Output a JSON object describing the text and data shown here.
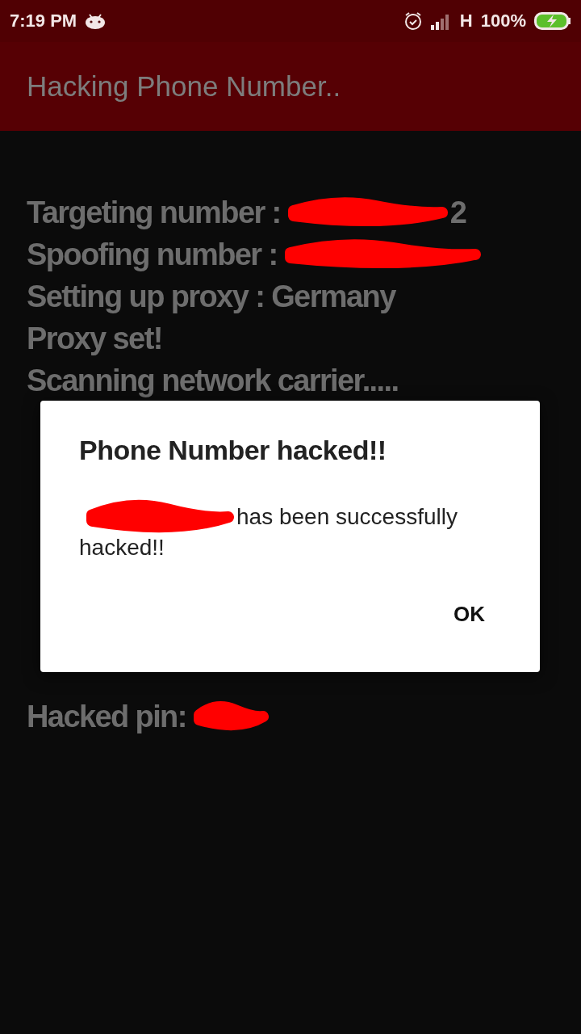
{
  "status_bar": {
    "time": "7:19 PM",
    "network": "H",
    "battery": "100%"
  },
  "app_bar": {
    "title": "Hacking Phone Number.."
  },
  "log": [
    {
      "kind": "text",
      "text": "Targeting number :",
      "redacted": true,
      "suffix": "2"
    },
    {
      "kind": "text",
      "text": "Spoofing number :",
      "redacted": true
    },
    {
      "kind": "text",
      "text": "Setting up proxy : Germany",
      "redacted": false
    },
    {
      "kind": "text",
      "text": "Proxy set!",
      "redacted": false
    },
    {
      "kind": "text",
      "text": "Scanning network carrier.....",
      "redacted": false
    },
    {
      "kind": "spacer"
    },
    {
      "kind": "spacer"
    },
    {
      "kind": "spacer"
    },
    {
      "kind": "spacer"
    },
    {
      "kind": "spacer"
    },
    {
      "kind": "spacer"
    },
    {
      "kind": "spacer"
    },
    {
      "kind": "text",
      "text": "Hacked pin:",
      "redacted": true
    }
  ],
  "dialog": {
    "title": "Phone Number hacked!!",
    "message_redacted": true,
    "message_lines": [
      "has been successfully",
      "hacked!!"
    ],
    "button": "OK"
  }
}
